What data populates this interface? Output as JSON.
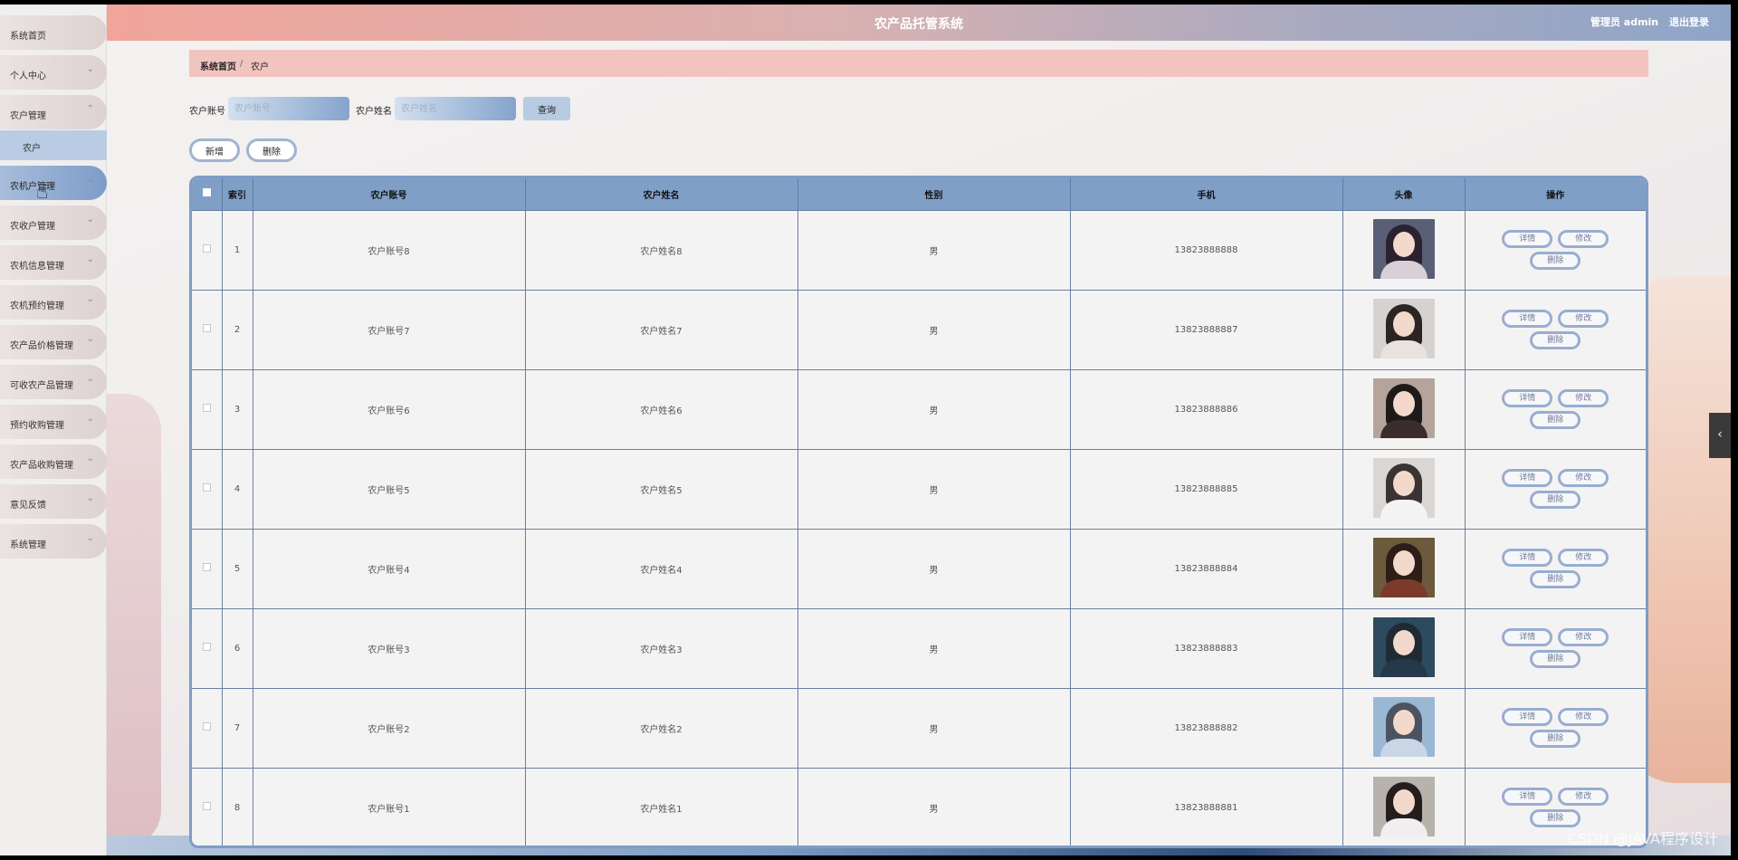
{
  "header": {
    "title": "农产品托管系统",
    "user_label": "管理员 admin",
    "logout_label": "退出登录"
  },
  "sidebar": {
    "items": [
      {
        "label": "系统首页",
        "chevron": false
      },
      {
        "label": "个人中心",
        "chevron": true
      },
      {
        "label": "农户管理",
        "chevron": true,
        "expanded": true
      },
      {
        "label": "农机户管理",
        "chevron": true,
        "active": true
      },
      {
        "label": "农收户管理",
        "chevron": true
      },
      {
        "label": "农机信息管理",
        "chevron": true
      },
      {
        "label": "农机预约管理",
        "chevron": true
      },
      {
        "label": "农产品价格管理",
        "chevron": true
      },
      {
        "label": "可收农产品管理",
        "chevron": true
      },
      {
        "label": "预约收购管理",
        "chevron": true
      },
      {
        "label": "农产品收购管理",
        "chevron": true
      },
      {
        "label": "意见反馈",
        "chevron": true
      },
      {
        "label": "系统管理",
        "chevron": true
      }
    ],
    "submenu": {
      "label": "农户"
    }
  },
  "breadcrumb": {
    "home": "系统首页",
    "separator": "/",
    "current": "农户"
  },
  "search": {
    "account_label": "农户账号",
    "account_placeholder": "农户账号",
    "name_label": "农户姓名",
    "name_placeholder": "农户姓名",
    "query_label": "查询"
  },
  "actions": {
    "add_label": "新增",
    "delete_label": "删除"
  },
  "table": {
    "columns": [
      "",
      "索引",
      "农户账号",
      "农户姓名",
      "性别",
      "手机",
      "头像",
      "操作"
    ],
    "row_buttons": {
      "detail": "详情",
      "edit": "修改",
      "delete": "删除"
    },
    "rows": [
      {
        "index": "1",
        "account": "农户账号8",
        "name": "农户姓名8",
        "gender": "男",
        "phone": "13823888888",
        "avatar": "avatar-1"
      },
      {
        "index": "2",
        "account": "农户账号7",
        "name": "农户姓名7",
        "gender": "男",
        "phone": "13823888887",
        "avatar": "avatar-2"
      },
      {
        "index": "3",
        "account": "农户账号6",
        "name": "农户姓名6",
        "gender": "男",
        "phone": "13823888886",
        "avatar": "avatar-3"
      },
      {
        "index": "4",
        "account": "农户账号5",
        "name": "农户姓名5",
        "gender": "男",
        "phone": "13823888885",
        "avatar": "avatar-4"
      },
      {
        "index": "5",
        "account": "农户账号4",
        "name": "农户姓名4",
        "gender": "男",
        "phone": "13823888884",
        "avatar": "avatar-5"
      },
      {
        "index": "6",
        "account": "农户账号3",
        "name": "农户姓名3",
        "gender": "男",
        "phone": "13823888883",
        "avatar": "avatar-6"
      },
      {
        "index": "7",
        "account": "农户账号2",
        "name": "农户姓名2",
        "gender": "男",
        "phone": "13823888882",
        "avatar": "avatar-7"
      },
      {
        "index": "8",
        "account": "农户账号1",
        "name": "农户姓名1",
        "gender": "男",
        "phone": "13823888881",
        "avatar": "avatar-8"
      }
    ]
  },
  "watermark": "CSDN @JAVA程序设计",
  "colors": {
    "accent": "#7f9fc7",
    "breadcrumb_bg": "#f2c4bf",
    "header_start": "#f0a49a",
    "header_end": "#8fa5c8"
  }
}
